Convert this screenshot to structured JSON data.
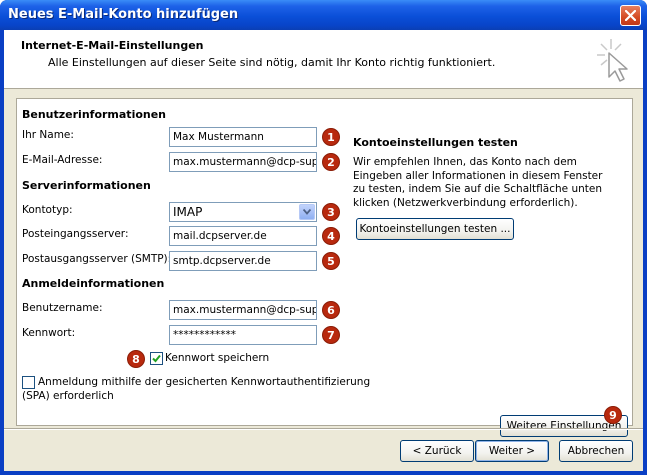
{
  "window": {
    "title": "Neues E-Mail-Konto hinzufügen"
  },
  "header": {
    "title": "Internet-E-Mail-Einstellungen",
    "subtitle": "Alle Einstellungen auf dieser Seite sind nötig, damit Ihr Konto richtig funktioniert."
  },
  "user_info": {
    "heading": "Benutzerinformationen",
    "name_label": "Ihr Name:",
    "name_value": "Max Mustermann",
    "email_label": "E-Mail-Adresse:",
    "email_value": "max.mustermann@dcp-suppo"
  },
  "server_info": {
    "heading": "Serverinformationen",
    "account_type_label": "Kontotyp:",
    "account_type_value": "IMAP",
    "incoming_label": "Posteingangsserver:",
    "incoming_value": "mail.dcpserver.de",
    "outgoing_label": "Postausgangsserver (SMTP):",
    "outgoing_value": "smtp.dcpserver.de"
  },
  "login_info": {
    "heading": "Anmeldeinformationen",
    "username_label": "Benutzername:",
    "username_value": "max.mustermann@dcp-suppo",
    "password_label": "Kennwort:",
    "password_value": "************",
    "remember_label": "Kennwort speichern",
    "remember_checked": true,
    "spa_label_line1": "Anmeldung mithilfe der gesicherten Kennwortauthentifizierung",
    "spa_label_line2": "(SPA) erforderlich",
    "spa_checked": false
  },
  "test": {
    "heading": "Kontoeinstellungen testen",
    "description": "Wir empfehlen Ihnen, das Konto nach dem Eingeben aller Informationen in diesem Fenster zu testen, indem Sie auf die Schaltfläche unten klicken (Netzwerkverbindung erforderlich).",
    "test_button": "Kontoeinstellungen testen ...",
    "more_settings_button": "Weitere Einstellungen"
  },
  "badges": [
    "1",
    "2",
    "3",
    "4",
    "5",
    "6",
    "7",
    "8",
    "9"
  ],
  "footer": {
    "back": "< Zurück",
    "next": "Weiter >",
    "cancel": "Abbrechen"
  },
  "colors": {
    "badge": "#b8290e",
    "titlebar": "#0a4fd8",
    "dialog_bg": "#ece9d8"
  },
  "icons": {
    "close": "close-icon",
    "wizard": "wizard-cursor-icon",
    "dropdown": "chevron-down-icon",
    "check": "check-icon"
  }
}
